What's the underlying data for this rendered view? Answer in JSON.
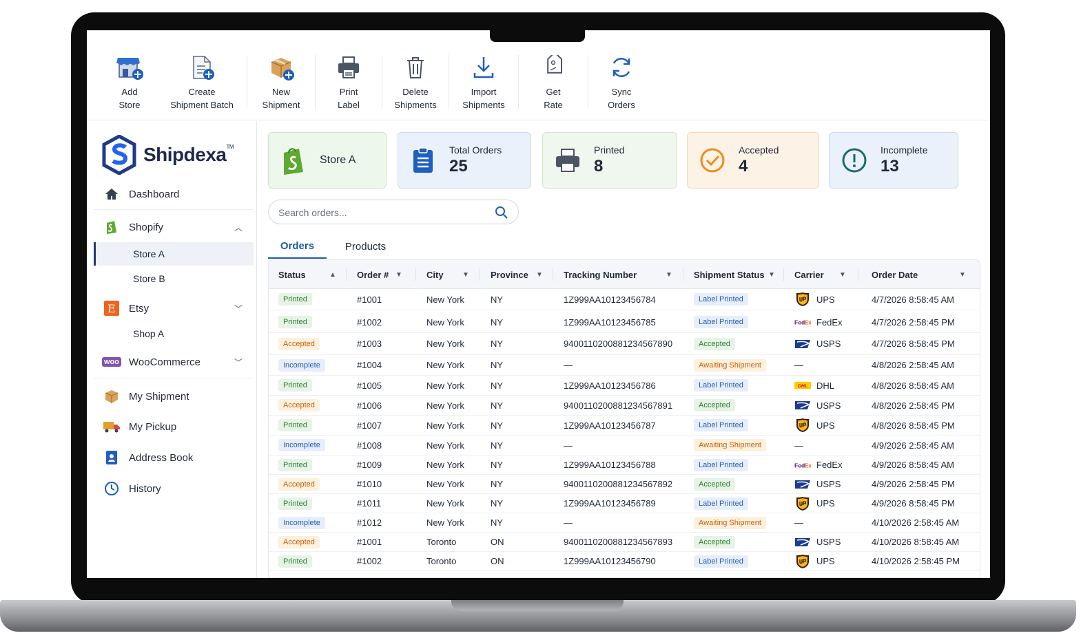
{
  "toolbar": {
    "items": [
      {
        "label": "Add\nStore",
        "icon": "add-store-icon"
      },
      {
        "label": "Create\nShipment Batch",
        "icon": "create-batch-icon"
      },
      {
        "label": "New\nShipment",
        "icon": "new-shipment-icon"
      },
      {
        "label": "Print\nLabel",
        "icon": "printer-icon"
      },
      {
        "label": "Delete\nShipments",
        "icon": "trash-icon"
      },
      {
        "label": "Import\nShipments",
        "icon": "download-icon"
      },
      {
        "label": "Get\nRate",
        "icon": "tag-icon"
      },
      {
        "label": "Sync\nOrders",
        "icon": "sync-icon"
      }
    ]
  },
  "sidebar": {
    "logo": {
      "name": "Shipdexa",
      "tm": "TM"
    },
    "dashboard": "Dashboard",
    "shopify": "Shopify",
    "store_a": "Store A",
    "store_b": "Store B",
    "etsy": "Etsy",
    "shop_a": "Shop A",
    "woocommerce": "WooCommerce",
    "woo_badge": "woo",
    "my_shipment": "My Shipment",
    "my_pickup": "My Pickup",
    "address_book": "Address Book",
    "history": "History"
  },
  "cards": {
    "store": {
      "title": "Store A"
    },
    "total": {
      "title": "Total Orders",
      "value": "25"
    },
    "printed": {
      "title": "Printed",
      "value": "8"
    },
    "accepted": {
      "title": "Accepted",
      "value": "4"
    },
    "incomplete": {
      "title": "Incomplete",
      "value": "13"
    }
  },
  "search": {
    "placeholder": "Search orders..."
  },
  "tabs": {
    "orders": "Orders",
    "products": "Products"
  },
  "table": {
    "headers": [
      "Status",
      "Order #",
      "City",
      "Province",
      "Tracking Number",
      "Shipment Status",
      "Carrier",
      "Order Date"
    ],
    "rows": [
      {
        "status": "Printed",
        "order": "#1001",
        "city": "New York",
        "province": "NY",
        "tracking": "1Z999AA10123456784",
        "ship_status": "Label Printed",
        "carrier": "UPS",
        "date": "4/7/2026 8:58:45 AM"
      },
      {
        "status": "Printed",
        "order": "#1002",
        "city": "New York",
        "province": "NY",
        "tracking": "1Z999AA10123456785",
        "ship_status": "Label Printed",
        "carrier": "FedEx",
        "date": "4/7/2026 2:58:45 PM"
      },
      {
        "status": "Accepted",
        "order": "#1003",
        "city": "New York",
        "province": "NY",
        "tracking": "9400110200881234567890",
        "ship_status": "Accepted",
        "carrier": "USPS",
        "date": "4/7/2026 8:58:45 PM"
      },
      {
        "status": "Incomplete",
        "order": "#1004",
        "city": "New York",
        "province": "NY",
        "tracking": "—",
        "ship_status": "Awaiting Shipment",
        "carrier": "—",
        "date": "4/8/2026 2:58:45 AM"
      },
      {
        "status": "Printed",
        "order": "#1005",
        "city": "New York",
        "province": "NY",
        "tracking": "1Z999AA10123456786",
        "ship_status": "Label Printed",
        "carrier": "DHL",
        "date": "4/8/2026 8:58:45 AM"
      },
      {
        "status": "Accepted",
        "order": "#1006",
        "city": "New York",
        "province": "NY",
        "tracking": "9400110200881234567891",
        "ship_status": "Accepted",
        "carrier": "USPS",
        "date": "4/8/2026 2:58:45 PM"
      },
      {
        "status": "Printed",
        "order": "#1007",
        "city": "New York",
        "province": "NY",
        "tracking": "1Z999AA10123456787",
        "ship_status": "Label Printed",
        "carrier": "UPS",
        "date": "4/8/2026 8:58:45 PM"
      },
      {
        "status": "Incomplete",
        "order": "#1008",
        "city": "New York",
        "province": "NY",
        "tracking": "—",
        "ship_status": "Awaiting Shipment",
        "carrier": "—",
        "date": "4/9/2026 2:58:45 AM"
      },
      {
        "status": "Printed",
        "order": "#1009",
        "city": "New York",
        "province": "NY",
        "tracking": "1Z999AA10123456788",
        "ship_status": "Label Printed",
        "carrier": "FedEx",
        "date": "4/9/2026 8:58:45 AM"
      },
      {
        "status": "Accepted",
        "order": "#1010",
        "city": "New York",
        "province": "NY",
        "tracking": "9400110200881234567892",
        "ship_status": "Accepted",
        "carrier": "USPS",
        "date": "4/9/2026 2:58:45 PM"
      },
      {
        "status": "Printed",
        "order": "#1011",
        "city": "New York",
        "province": "NY",
        "tracking": "1Z999AA10123456789",
        "ship_status": "Label Printed",
        "carrier": "UPS",
        "date": "4/9/2026 8:58:45 PM"
      },
      {
        "status": "Incomplete",
        "order": "#1012",
        "city": "New York",
        "province": "NY",
        "tracking": "—",
        "ship_status": "Awaiting Shipment",
        "carrier": "—",
        "date": "4/10/2026 2:58:45 AM"
      },
      {
        "status": "Accepted",
        "order": "#1001",
        "city": "Toronto",
        "province": "ON",
        "tracking": "9400110200881234567893",
        "ship_status": "Accepted",
        "carrier": "USPS",
        "date": "4/10/2026 8:58:45 AM"
      },
      {
        "status": "Printed",
        "order": "#1002",
        "city": "Toronto",
        "province": "ON",
        "tracking": "1Z999AA10123456790",
        "ship_status": "Label Printed",
        "carrier": "UPS",
        "date": "4/10/2026 2:58:45 PM"
      }
    ]
  },
  "colors": {
    "accent": "#1e5aa8",
    "card_store": "#eef7ec",
    "card_total": "#eaf1fb",
    "card_printed": "#f0f7ee",
    "card_accepted": "#fdf2e6",
    "card_incomplete": "#eaf1fb"
  }
}
